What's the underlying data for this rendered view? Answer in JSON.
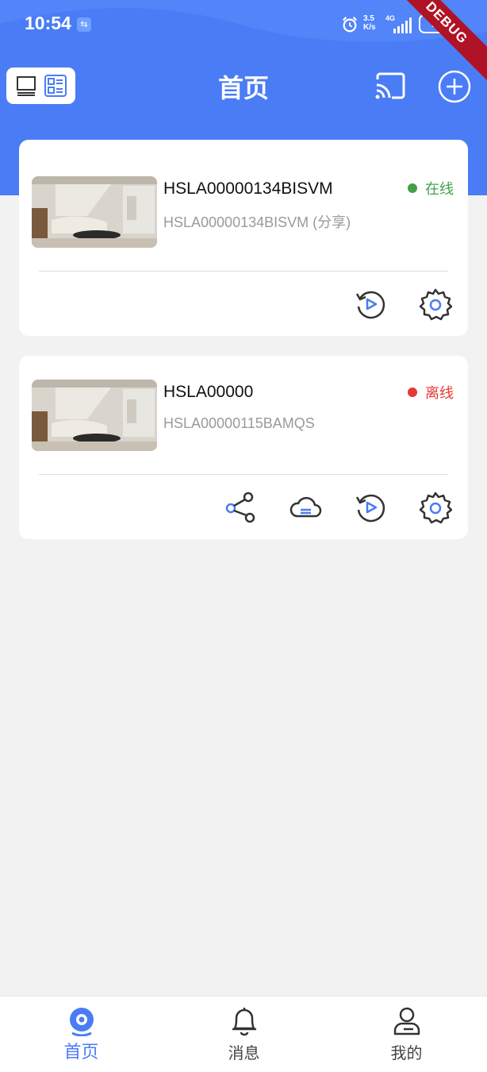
{
  "status_bar": {
    "time": "10:54",
    "speed_top": "3.5",
    "speed_bottom": "K/s",
    "network": "4G",
    "battery": "75"
  },
  "debug_banner": "DEBUG",
  "header": {
    "title": "首页"
  },
  "devices": [
    {
      "name": "HSLA00000134BISVM",
      "subtitle": "HSLA00000134BISVM (分享)",
      "status": "在线",
      "status_color": "#43a047",
      "actions": [
        "playback-icon",
        "settings-icon"
      ]
    },
    {
      "name": "HSLA00000",
      "subtitle": "HSLA00000115BAMQS",
      "status": "离线",
      "status_color": "#e53935",
      "actions": [
        "share-icon",
        "cloud-icon",
        "playback-icon",
        "settings-icon"
      ]
    }
  ],
  "bottom_nav": {
    "items": [
      {
        "label": "首页",
        "icon": "camera-home-icon",
        "active": true
      },
      {
        "label": "消息",
        "icon": "bell-icon",
        "active": false
      },
      {
        "label": "我的",
        "icon": "user-icon",
        "active": false
      }
    ]
  },
  "colors": {
    "primary": "#4a7cf5",
    "online": "#43a047",
    "offline": "#e53935"
  }
}
